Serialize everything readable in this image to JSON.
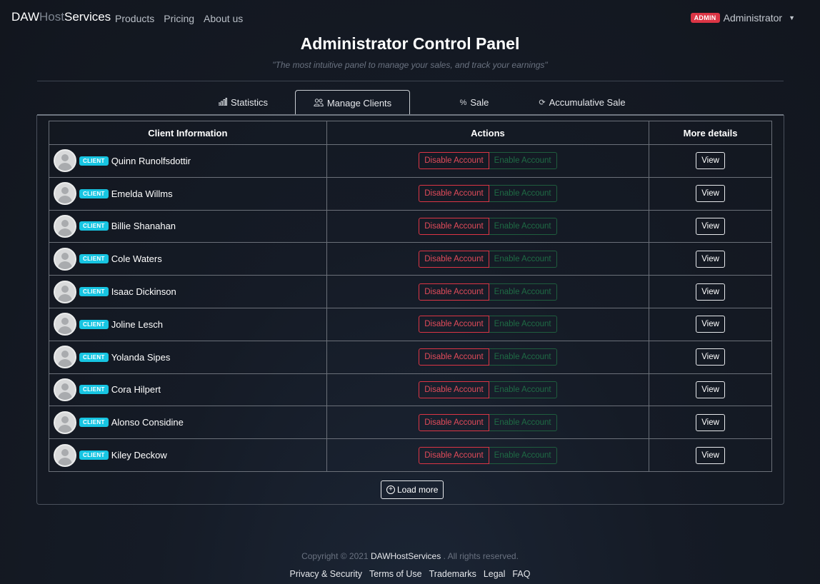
{
  "navbar": {
    "brand_daw": "DAW",
    "brand_host": "Host",
    "brand_services": "Services",
    "links": [
      "Products",
      "Pricing",
      "About us"
    ],
    "admin_badge": "ADMIN",
    "user_name": "Administrator",
    "caret_icon": "caret-down-icon"
  },
  "header": {
    "title": "Administrator Control Panel",
    "subtitle": "\"The most intuitive panel to manage your sales, and track your earnings\""
  },
  "tabs": [
    {
      "label": "Statistics",
      "icon": "bar-chart-icon",
      "active": false
    },
    {
      "label": "Manage Clients",
      "icon": "users-icon",
      "active": true
    },
    {
      "label": "Sale",
      "icon": "percent-icon",
      "active": false
    },
    {
      "label": "Accumulative Sale",
      "icon": "refresh-icon",
      "active": false
    }
  ],
  "table": {
    "headers": [
      "Client Information",
      "Actions",
      "More details"
    ],
    "client_badge": "CLIENT",
    "disable_label": "Disable Account",
    "enable_label": "Enable Account",
    "view_label": "View",
    "rows": [
      {
        "name": "Quinn Runolfsdottir"
      },
      {
        "name": "Emelda Willms"
      },
      {
        "name": "Billie Shanahan"
      },
      {
        "name": "Cole Waters"
      },
      {
        "name": "Isaac Dickinson"
      },
      {
        "name": "Joline Lesch"
      },
      {
        "name": "Yolanda Sipes"
      },
      {
        "name": "Cora Hilpert"
      },
      {
        "name": "Alonso Considine"
      },
      {
        "name": "Kiley Deckow"
      }
    ]
  },
  "load_more": "Load more",
  "footer": {
    "copyright_prefix": "Copyright © 2021",
    "copyright_brand": "DAWHostServices",
    "copyright_suffix": ". All rights reserved.",
    "links": [
      "Privacy & Security",
      "Terms of Use",
      "Trademarks",
      "Legal",
      "FAQ"
    ]
  },
  "colors": {
    "admin_badge": "#dc3545",
    "client_badge": "#17c5e2",
    "disable": "#dc3545",
    "enable": "#1f6b45"
  }
}
